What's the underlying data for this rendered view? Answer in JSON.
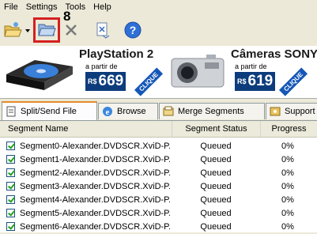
{
  "menu": [
    "File",
    "Settings",
    "Tools",
    "Help"
  ],
  "callout_number": "8",
  "ads": [
    {
      "title": "PlayStation 2",
      "sub": "a partir de",
      "currency": "R$",
      "price": "669",
      "cta": "CLIQUE"
    },
    {
      "title": "Câmeras SONY",
      "sub": "a partir de",
      "currency": "R$",
      "price": "619",
      "cta": "CLIQUE"
    }
  ],
  "tabs": [
    "Split/Send File",
    "Browse",
    "Merge Segments",
    "Support"
  ],
  "columns": {
    "name": "Segment Name",
    "status": "Segment Status",
    "progress": "Progress"
  },
  "rows": [
    {
      "name": "Segment0-Alexander.DVDSCR.XviD-P...",
      "status": "Queued",
      "progress": "0%"
    },
    {
      "name": "Segment1-Alexander.DVDSCR.XviD-P...",
      "status": "Queued",
      "progress": "0%"
    },
    {
      "name": "Segment2-Alexander.DVDSCR.XviD-P...",
      "status": "Queued",
      "progress": "0%"
    },
    {
      "name": "Segment3-Alexander.DVDSCR.XviD-P...",
      "status": "Queued",
      "progress": "0%"
    },
    {
      "name": "Segment4-Alexander.DVDSCR.XviD-P...",
      "status": "Queued",
      "progress": "0%"
    },
    {
      "name": "Segment5-Alexander.DVDSCR.XviD-P...",
      "status": "Queued",
      "progress": "0%"
    },
    {
      "name": "Segment6-Alexander.DVDSCR.XviD-P...",
      "status": "Queued",
      "progress": "0%"
    }
  ]
}
